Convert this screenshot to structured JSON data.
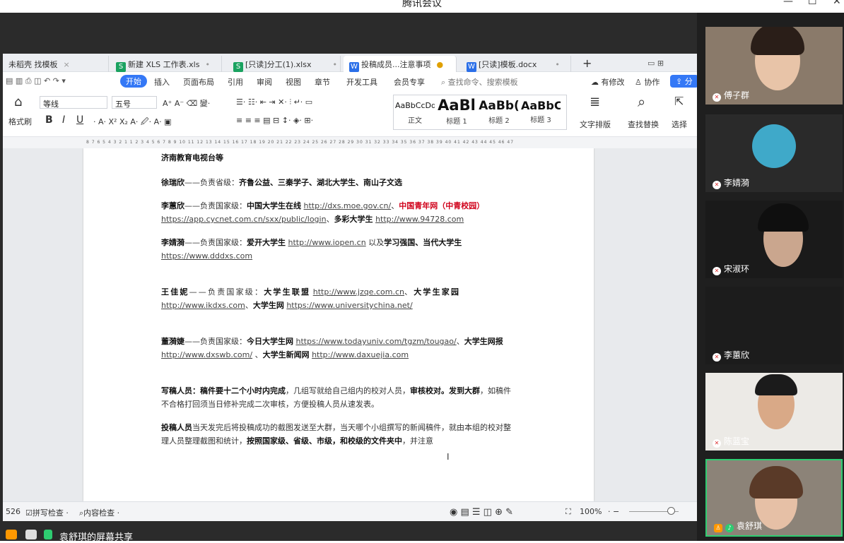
{
  "window": {
    "title": "腾讯会议",
    "controls": [
      "—",
      "☐",
      "✕"
    ]
  },
  "tabs": [
    {
      "icon": "",
      "label": "未稻壳 找模板",
      "icon_color": "#e74c3c"
    },
    {
      "icon": "S",
      "label": "新建 XLS 工作表.xls",
      "icon_color": "#1aa260"
    },
    {
      "icon": "S",
      "label": "[只读]分工(1).xlsx",
      "icon_color": "#1aa260"
    },
    {
      "icon": "W",
      "label": "投稿成员...注意事项",
      "icon_color": "#2b6fe8"
    },
    {
      "icon": "W",
      "label": "[只读]模板.docx",
      "icon_color": "#2b6fe8"
    }
  ],
  "tab_add": "+",
  "menu": {
    "items": [
      "开始",
      "插入",
      "页面布局",
      "引用",
      "审阅",
      "视图",
      "章节",
      "开发工具",
      "会员专享"
    ],
    "search": "查找命令、搜索模板",
    "right": [
      "有修改",
      "协作",
      "分"
    ]
  },
  "ribbon": {
    "format_painter": "格式刷",
    "font": "等线",
    "size": "五号",
    "bold": "B",
    "italic": "I",
    "underline": "U",
    "styles": [
      {
        "preview": "AaBbCcDd",
        "label": "正文"
      },
      {
        "preview": "AaBl",
        "label": "标题 1"
      },
      {
        "preview": "AaBb(",
        "label": "标题 2"
      },
      {
        "preview": "AaBbC",
        "label": "标题 3"
      }
    ],
    "text_layout": "文字排版",
    "find_replace": "查找替换",
    "select": "选择"
  },
  "ruler": "8 7 6 5 4 3 2 1   1 2 3 4 5 6 7 8 9 10 11 12 13 14 15 16 17 18 19 20 21 22 23 24 25 26 27 28 29 30 31 32 33 34 35 36 37 38 39 40 41 42 43 44 45 46 47",
  "doc": {
    "p0": "济南教育电视台等",
    "p1_name": "徐瑞欣",
    "p1_dash": "——负责省级：",
    "p1_bold": "齐鲁公益、三秦学子、湖北大学生、南山子文选",
    "p2_name": "李蕙欣",
    "p2_dash": "——负责国家级：",
    "p2_b1": "中国大学生在线",
    "p2_u1": "http://dxs.moe.gov.cn/",
    "p2_sep": "、",
    "p2_red": "中国青年网（中青校园）",
    "p2_u2": "https://app.cycnet.com.cn/sxx/public/login",
    "p2_sep2": "、",
    "p2_b2": "多彩大学生",
    "p2_u3": "http://www.94728.com",
    "p3_name": "李婧漪",
    "p3_dash": "——负责国家级：",
    "p3_b1": "爱开大学生",
    "p3_u1": "http://www.iopen.cn",
    "p3_t": " 以及",
    "p3_b2": "学习强国、当代大学生",
    "p3_u2": "https://www.dddxs.com",
    "p4_name": "王佳妮",
    "p4_dash": "——负责国家级：",
    "p4_b1": "大学生联盟",
    "p4_u1": "http://www.jzqe.com.cn",
    "p4_sep": "、",
    "p4_b2": "大学生家园",
    "p4_u2": "http://www.ikdxs.com",
    "p4_sep2": "、",
    "p4_b3": "大学生网",
    "p4_u3": "https://www.universitychina.net/",
    "p5_name": "董漪婕",
    "p5_dash": "——负责国家级：",
    "p5_b1": "今日大学生网",
    "p5_u1": "https://www.todayuniv.com/tgzm/tougao/",
    "p5_sep": "、",
    "p5_b2": "大学生网报",
    "p5_u2": "http://www.dxswb.com/",
    "p5_sep2": " 、",
    "p5_b3": "大学生新闻网",
    "p5_u3": "http://www.daxuejia.com",
    "p6_b1": "写稿人员：稿件要十二个小时内完成",
    "p6_t1": "，几组写就给自己组内的校对人员，",
    "p6_b2": "审核校对。发到大群",
    "p6_t2": "，如稿件不合格打回须当日修补完成二次审核，方便投稿人员从速发表。",
    "p7_b1": "投稿人员",
    "p7_t1": "当天发完后将投稿成功的截图发送至大群，当天哪个小组撰写的新闻稿件，就由本组的校对整理人员整理截图和统计，",
    "p7_b2": "按照国家级、省级、市级，和校级的文件夹中",
    "p7_t2": "，并注意"
  },
  "status": {
    "words": "526",
    "spell": "拼写检查",
    "content": "内容检查",
    "zoom": "100%"
  },
  "share_label": "袁舒琪的屏幕共享",
  "participants": [
    {
      "name": "傅子群"
    },
    {
      "name": "李婧漪"
    },
    {
      "name": "宋淑环"
    },
    {
      "name": "李蕙欣"
    },
    {
      "name": "陈蓝宝"
    },
    {
      "name": "袁舒琪"
    }
  ]
}
